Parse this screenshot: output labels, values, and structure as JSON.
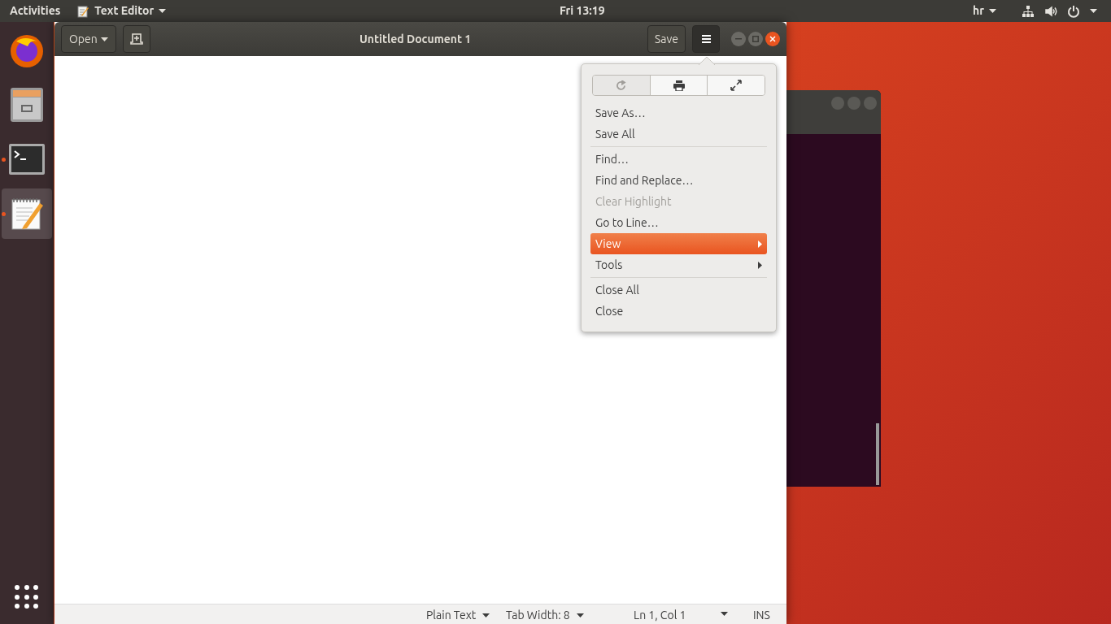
{
  "top_bar": {
    "activities": "Activities",
    "app_menu": "Text Editor",
    "clock": "Fri 13:19",
    "keyboard_layout": "hr"
  },
  "dock": {
    "items": [
      {
        "kind": "browser",
        "running": false,
        "selected": false
      },
      {
        "kind": "files",
        "running": false,
        "selected": false
      },
      {
        "kind": "terminal",
        "running": true,
        "selected": false
      },
      {
        "kind": "editor",
        "running": true,
        "selected": true
      }
    ]
  },
  "window": {
    "title": "Untitled Document 1",
    "open_button": "Open",
    "save_button": "Save"
  },
  "menu": {
    "toolbar": [
      {
        "kind": "reload",
        "disabled": true
      },
      {
        "kind": "print",
        "disabled": false
      },
      {
        "kind": "fullscreen",
        "disabled": false
      }
    ],
    "sections": [
      [
        {
          "label": "Save As…",
          "disabled": false,
          "selected": false,
          "submenu": false
        },
        {
          "label": "Save All",
          "disabled": false,
          "selected": false,
          "submenu": false
        }
      ],
      [
        {
          "label": "Find…",
          "disabled": false,
          "selected": false,
          "submenu": false
        },
        {
          "label": "Find and Replace…",
          "disabled": false,
          "selected": false,
          "submenu": false
        },
        {
          "label": "Clear Highlight",
          "disabled": true,
          "selected": false,
          "submenu": false
        },
        {
          "label": "Go to Line…",
          "disabled": false,
          "selected": false,
          "submenu": false
        },
        {
          "label": "View",
          "disabled": false,
          "selected": true,
          "submenu": true
        },
        {
          "label": "Tools",
          "disabled": false,
          "selected": false,
          "submenu": true
        }
      ],
      [
        {
          "label": "Close All",
          "disabled": false,
          "selected": false,
          "submenu": false
        },
        {
          "label": "Close",
          "disabled": false,
          "selected": false,
          "submenu": false
        }
      ]
    ]
  },
  "status_bar": {
    "language": "Plain Text",
    "tab_width": "Tab Width: 8",
    "position": "Ln 1, Col 1",
    "mode": "INS"
  }
}
